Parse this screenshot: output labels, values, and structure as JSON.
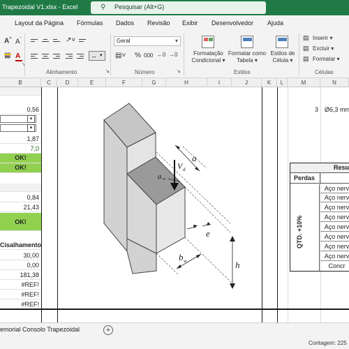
{
  "window": {
    "title": "Trapezoidal V1.xlsx  -  Excel",
    "search_placeholder": "Pesquisar (Alt+G)"
  },
  "menu": {
    "items": [
      "Layout da Página",
      "Fórmulas",
      "Dados",
      "Revisão",
      "Exibir",
      "Desenvolvedor",
      "Ajuda"
    ]
  },
  "ribbon": {
    "number_format": "Geral",
    "groups": {
      "alignment": "Alinhamento",
      "number": "Número",
      "styles": "Estilos",
      "cells": "Células"
    },
    "styles": {
      "conditional": "Formatação\nCondicional ▾",
      "table": "Formatar como\nTabela ▾",
      "cell_styles": "Estilos de\nCélula ▾"
    },
    "cells": {
      "insert": "Inserir ▾",
      "delete": "Excluir ▾",
      "format": "Formatar ▾"
    },
    "num_symbols": {
      "percent": "%",
      "thousands": "000"
    },
    "percent_and_thousands_icons": [
      "percent-icon",
      "thousands-icon"
    ]
  },
  "columns": [
    "B",
    "C",
    "D",
    "E",
    "F",
    "G",
    "H",
    "I",
    "J",
    "K",
    "L",
    "M",
    "N"
  ],
  "col_b_cells": {
    "v056": "0,56",
    "v187": "1,87",
    "v70": "7,0",
    "ok1": "OK!",
    "ok2": "OK!",
    "v084": "0,84",
    "v2143": "21,43",
    "ok3": "OK!",
    "cisalhamento": "Cisalhamento",
    "v3000": "30,00",
    "v000": "0,00",
    "v18138": "181,38",
    "ref1": "#REF!",
    "ref2": "#REF!",
    "ref3": "#REF!"
  },
  "right_panel": {
    "qty": "3",
    "diameter": "Ø6,3 mm",
    "table_header": "Resu",
    "perdas": "Perdas",
    "qtd": "QTD. +10%",
    "aco_rows": [
      "Aço nerv",
      "Aço nerv",
      "Aço nerv",
      "Aço nerv",
      "Aço nerv",
      "Aço nerv",
      "Aço nerv",
      "Aço nerv"
    ],
    "last_row": "Concr"
  },
  "figure_labels": {
    "a": "a",
    "vd": "V",
    "vd_sub": "d",
    "aw": "a",
    "aw_sub": "w",
    "e": "e",
    "bw": "b",
    "bw_sub": "w",
    "h": "h"
  },
  "sheet_tab": "emorial Consolo Trapezoidal",
  "status": "Contagem: 225"
}
